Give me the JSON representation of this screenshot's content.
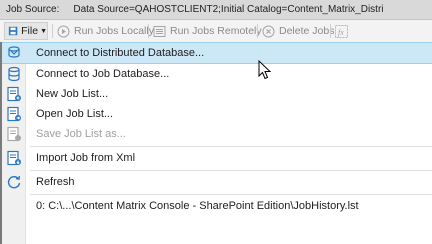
{
  "source_bar": {
    "label": "Job Source:",
    "value": "Data Source=QAHOSTCLIENT2;Initial Catalog=Content_Matrix_Distri"
  },
  "toolbar": {
    "file_label": "File",
    "run_local_label": "Run Jobs Locally",
    "run_remote_label": "Run Jobs Remotely",
    "delete_label": "Delete Jobs"
  },
  "menu": {
    "items": [
      {
        "label": "Connect to Distributed Database...",
        "icon": "distributed-database-icon"
      },
      {
        "label": "Connect to Job Database...",
        "icon": "database-icon"
      },
      {
        "label": "New Job List...",
        "icon": "new-job-list-icon"
      },
      {
        "label": "Open Job List...",
        "icon": "open-job-list-icon"
      },
      {
        "label": "Save Job List as...",
        "icon": "save-job-list-icon"
      },
      {
        "label": "Import Job from Xml",
        "icon": "import-xml-icon"
      },
      {
        "label": "Refresh",
        "icon": "refresh-icon"
      },
      {
        "label": "0: C:\\...\\Content Matrix Console - SharePoint Edition\\JobHistory.lst"
      }
    ]
  },
  "colors": {
    "highlight": "#cce8f7",
    "icon_blue": "#2b78c2"
  }
}
